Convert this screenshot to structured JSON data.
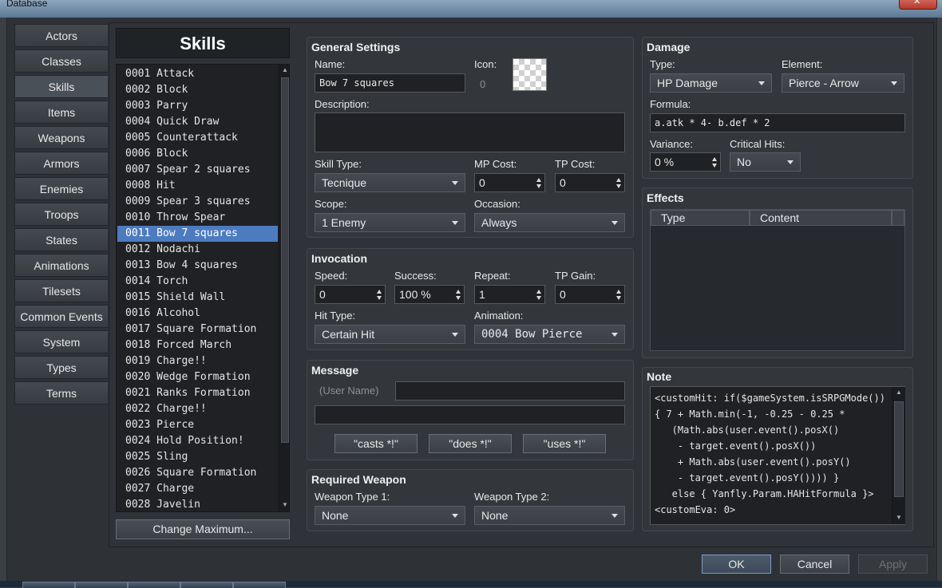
{
  "window": {
    "title": "Database"
  },
  "categories": [
    "Actors",
    "Classes",
    "Skills",
    "Items",
    "Weapons",
    "Armors",
    "Enemies",
    "Troops",
    "States",
    "Animations",
    "Tilesets",
    "Common Events",
    "System",
    "Types",
    "Terms"
  ],
  "active_category": "Skills",
  "list": {
    "header": "Skills",
    "items": [
      "0001 Attack",
      "0002 Block",
      "0003 Parry",
      "0004 Quick Draw",
      "0005 Counterattack",
      "0006 Block",
      "0007 Spear 2 squares",
      "0008 Hit",
      "0009 Spear 3 squares",
      "0010 Throw Spear",
      "0011 Bow 7 squares",
      "0012 Nodachi",
      "0013 Bow 4 squares",
      "0014 Torch",
      "0015 Shield Wall",
      "0016 Alcohol",
      "0017 Square Formation",
      "0018 Forced March",
      "0019 Charge!!",
      "0020 Wedge Formation",
      "0021 Ranks Formation",
      "0022 Charge!!",
      "0023 Pierce",
      "0024 Hold Position!",
      "0025 Sling",
      "0026 Square Formation",
      "0027 Charge",
      "0028 Javelin"
    ],
    "selected_index": 10,
    "change_max_label": "Change Maximum..."
  },
  "general": {
    "title": "General Settings",
    "name_label": "Name:",
    "name_value": "Bow 7 squares",
    "icon_label": "Icon:",
    "icon_index": "0",
    "description_label": "Description:",
    "description_value": "",
    "skill_type_label": "Skill Type:",
    "skill_type_value": "Tecnique",
    "mp_cost_label": "MP Cost:",
    "mp_cost_value": "0",
    "tp_cost_label": "TP Cost:",
    "tp_cost_value": "0",
    "scope_label": "Scope:",
    "scope_value": "1 Enemy",
    "occasion_label": "Occasion:",
    "occasion_value": "Always"
  },
  "invocation": {
    "title": "Invocation",
    "speed_label": "Speed:",
    "speed_value": "0",
    "success_label": "Success:",
    "success_value": "100 %",
    "repeat_label": "Repeat:",
    "repeat_value": "1",
    "tp_gain_label": "TP Gain:",
    "tp_gain_value": "0",
    "hit_type_label": "Hit Type:",
    "hit_type_value": "Certain Hit",
    "animation_label": "Animation:",
    "animation_value": "0004 Bow Pierce"
  },
  "message": {
    "title": "Message",
    "user_name_label": "(User Name)",
    "line1": "",
    "line2": "",
    "buttons": [
      "\"casts *!\"",
      "\"does *!\"",
      "\"uses *!\""
    ]
  },
  "required_weapon": {
    "title": "Required Weapon",
    "type1_label": "Weapon Type 1:",
    "type1_value": "None",
    "type2_label": "Weapon Type 2:",
    "type2_value": "None"
  },
  "damage": {
    "title": "Damage",
    "type_label": "Type:",
    "type_value": "HP Damage",
    "element_label": "Element:",
    "element_value": "Pierce - Arrow",
    "formula_label": "Formula:",
    "formula_value": "a.atk * 4- b.def * 2",
    "variance_label": "Variance:",
    "variance_value": "0 %",
    "critical_label": "Critical Hits:",
    "critical_value": "No"
  },
  "effects": {
    "title": "Effects",
    "columns": [
      "Type",
      "Content"
    ]
  },
  "note": {
    "title": "Note",
    "lines": [
      "<customHit: if($gameSystem.isSRPGMode())",
      "{ 7 + Math.min(-1, -0.25 - 0.25 *",
      "   (Math.abs(user.event().posX()",
      "    - target.event().posX())",
      "    + Math.abs(user.event().posY()",
      "    - target.event().posY()))) }",
      "   else { Yanfly.Param.HAHitFormula }>",
      "<customEva: 0>"
    ]
  },
  "footer": {
    "ok": "OK",
    "cancel": "Cancel",
    "apply": "Apply"
  }
}
